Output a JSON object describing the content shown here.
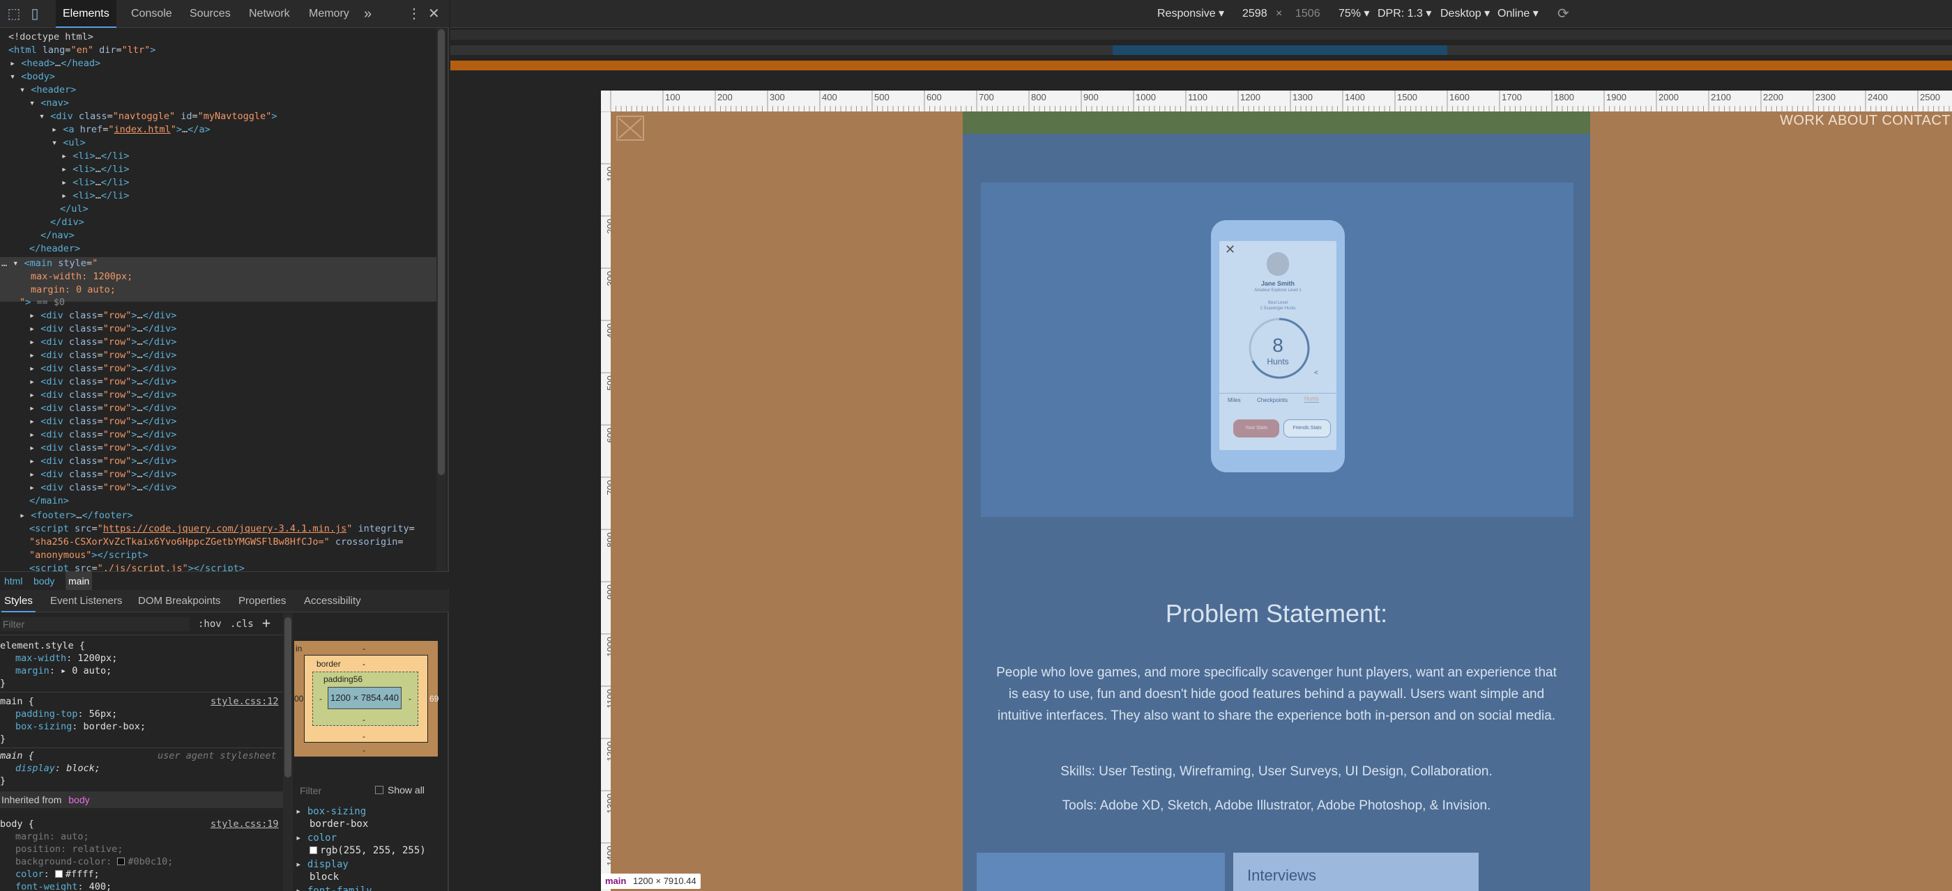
{
  "devtools": {
    "tabs": [
      "Elements",
      "Console",
      "Sources",
      "Network",
      "Memory"
    ],
    "more_label": "»",
    "dom_lines": [
      {
        "html": "<span class='tx'>&lt;!doctype html&gt;</span>"
      },
      {
        "html": "<span class='tg'>&lt;html</span> <span class='at'>lang</span>=<span class='av'>\"en\"</span> <span class='at'>dir</span>=<span class='av'>\"ltr\"</span><span class='tg'>&gt;</span>"
      },
      {
        "html": "<span class='tx'>▸ </span><span class='tg'>&lt;head&gt;</span>…<span class='tg'>&lt;/head&gt;</span>"
      }
    ],
    "breadcrumbs": [
      "html",
      "body",
      "main"
    ],
    "sub_tabs": [
      "Styles",
      "Event Listeners",
      "DOM Breakpoints",
      "Properties",
      "Accessibility"
    ],
    "filter_placeholder": "Filter",
    "hov": ":hov",
    "cls": ".cls",
    "plus": "+",
    "inherited_from": "Inherited from",
    "inherited_tag": "body",
    "box_model": {
      "border": "border",
      "padding": "padding56",
      "content": "1200 × 7854.440",
      "dash": "-",
      "side_left": "00",
      "side_right": "69",
      "margin_label": "in"
    },
    "computed_filter": "Filter",
    "show_all": "Show all"
  },
  "device": {
    "mode": "Responsive",
    "width": "2598",
    "x": "×",
    "height": "1506",
    "zoom": "75%",
    "dpr": "DPR: 1.3",
    "device_type": "Desktop",
    "network": "Online"
  },
  "site": {
    "nav": "WORK ABOUT CONTACT",
    "phone_name": "Jane Smith",
    "phone_sub": "Amateur Explorer Level 1",
    "phone_stat1": "Best Level",
    "phone_stat2": "2 Scavenger Hunts",
    "hunts_number": "8",
    "hunts_label": "Hunts",
    "tab_miles": "Miles",
    "tab_checkpoints": "Checkpoints",
    "tab_hunts": "Hunts",
    "your_stats": "Your Stats",
    "friends_stats": "Friends Stats",
    "problem_title": "Problem Statement:",
    "problem_body": "People who love games, and more specifically scavenger hunt players, want an experience that is easy to use, fun and doesn't hide good features behind a paywall. Users want simple and intuitive interfaces. They also want to share the experience both in-person and on social media.",
    "skills": "Skills: User Testing, Wireframing, User Surveys, UI Design, Collaboration.",
    "tools": "Tools: Adobe XD, Sketch, Adobe Illustrator, Adobe Photoshop, & Invision.",
    "interviews": "Interviews"
  },
  "size_badge_tag": "main",
  "size_badge_dims": "1200 × 7910.44"
}
